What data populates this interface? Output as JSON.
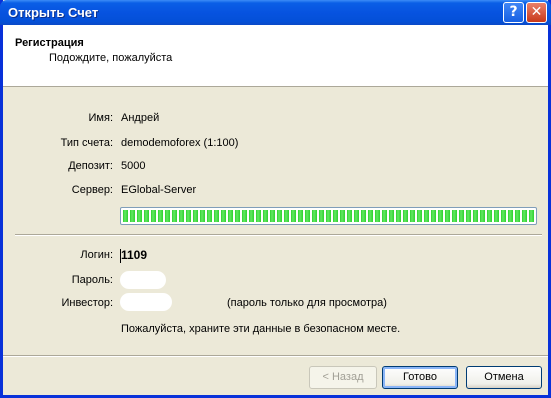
{
  "window": {
    "title": "Открыть Счет"
  },
  "titlebar_buttons": {
    "help": "?",
    "close": "✕"
  },
  "header": {
    "title": "Регистрация",
    "subtitle": "Подождите, пожалуйста"
  },
  "account": {
    "name_label": "Имя:",
    "name_value": "Андрей",
    "type_label": "Тип счета:",
    "type_value": "demodemoforex (1:100)",
    "deposit_label": "Депозит:",
    "deposit_value": "5000",
    "server_label": "Сервер:",
    "server_value": "EGlobal-Server"
  },
  "progress": {
    "percent": 100
  },
  "credentials": {
    "login_label": "Логин:",
    "login_value": "1109",
    "password_label": "Пароль:",
    "investor_label": "Инвестор:",
    "investor_hint": "(пароль только для просмотра)",
    "note": "Пожалуйста, храните эти данные в безопасном месте."
  },
  "buttons": {
    "back": "< Назад",
    "done": "Готово",
    "cancel": "Отмена"
  }
}
